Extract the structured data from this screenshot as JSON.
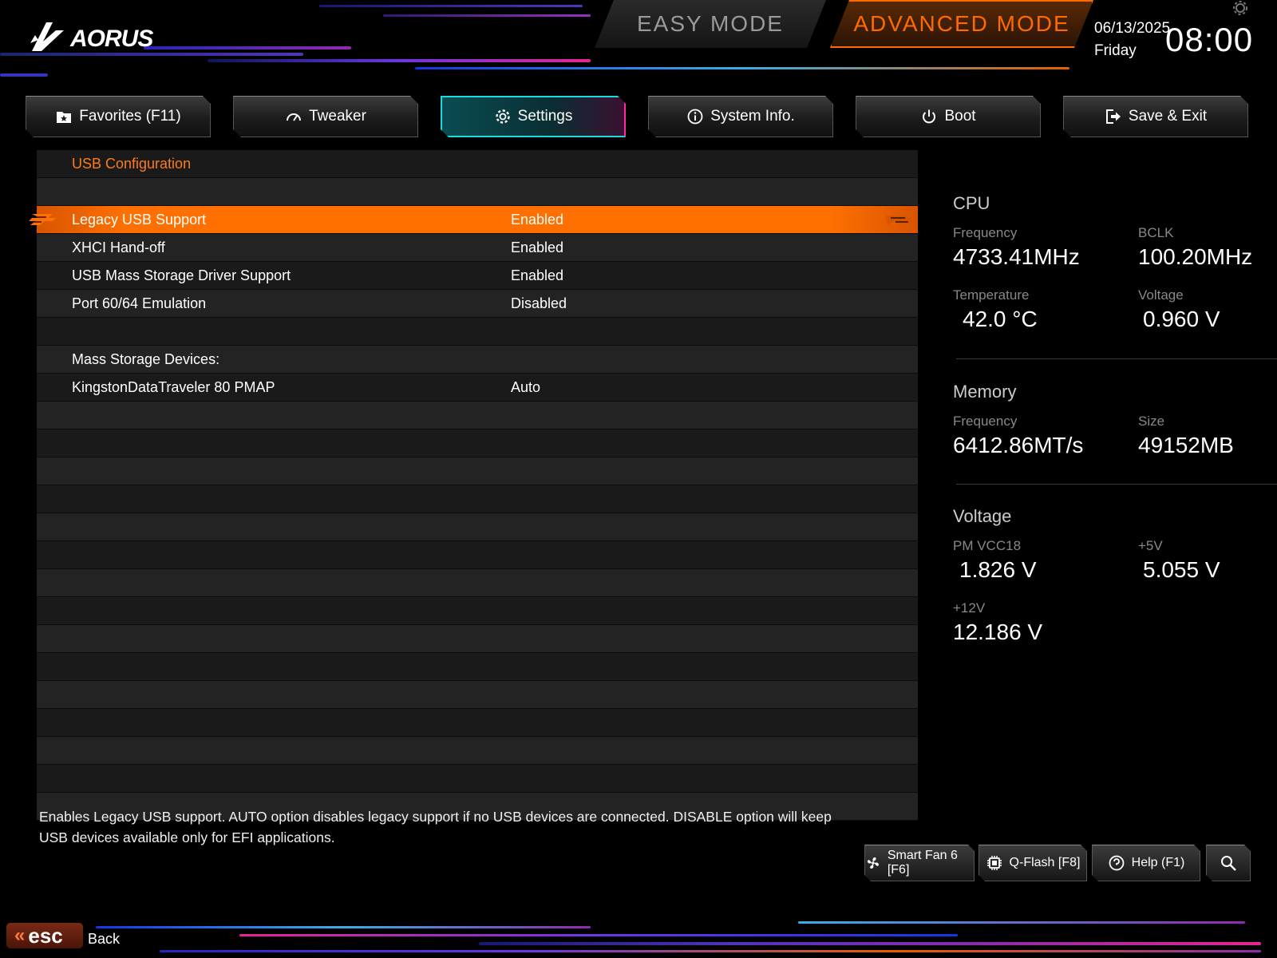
{
  "header": {
    "logo_text": "AORUS",
    "easy_mode": "EASY MODE",
    "advanced_mode": "ADVANCED MODE",
    "date": "06/13/2025",
    "day": "Friday",
    "time": "08:00"
  },
  "tabs": [
    {
      "label": "Favorites (F11)",
      "icon": "star-folder-icon"
    },
    {
      "label": "Tweaker",
      "icon": "gauge-icon"
    },
    {
      "label": "Settings",
      "icon": "gear-icon",
      "active": true
    },
    {
      "label": "System Info.",
      "icon": "info-icon"
    },
    {
      "label": "Boot",
      "icon": "power-icon"
    },
    {
      "label": "Save & Exit",
      "icon": "exit-icon"
    }
  ],
  "settings": {
    "section_title": "USB Configuration",
    "rows": [
      {
        "label": "Legacy USB Support",
        "value": "Enabled"
      },
      {
        "label": "XHCI Hand-off",
        "value": "Enabled"
      },
      {
        "label": "USB Mass Storage Driver Support",
        "value": "Enabled"
      },
      {
        "label": "Port 60/64 Emulation",
        "value": "Disabled"
      },
      {
        "label": "Mass Storage Devices:",
        "value": ""
      },
      {
        "label": "KingstonDataTraveler 80 PMAP",
        "value": "Auto"
      }
    ]
  },
  "monitor": {
    "cpu": {
      "title": "CPU",
      "frequency_label": "Frequency",
      "frequency": "4733.41MHz",
      "bclk_label": "BCLK",
      "bclk": "100.20MHz",
      "temperature_label": "Temperature",
      "temperature": "42.0 °C",
      "voltage_label": "Voltage",
      "voltage": "0.960 V"
    },
    "memory": {
      "title": "Memory",
      "frequency_label": "Frequency",
      "frequency": "6412.86MT/s",
      "size_label": "Size",
      "size": "49152MB"
    },
    "voltage": {
      "title": "Voltage",
      "pm_label": "PM VCC18",
      "pm": "1.826 V",
      "p5_label": "+5V",
      "p5": "5.055 V",
      "p12_label": "+12V",
      "p12": "12.186 V"
    }
  },
  "description": "Enables Legacy USB support. AUTO option disables legacy support if no USB devices are connected. DISABLE option will keep USB devices available only for EFI applications.",
  "bottom_buttons": {
    "smart_fan": "Smart Fan 6 [F6]",
    "qflash": "Q-Flash [F8]",
    "help": "Help (F1)"
  },
  "footer": {
    "esc": "esc",
    "back": "Back"
  },
  "colors": {
    "accent": "#ff6a00",
    "active_tab": "#20d8e0",
    "active_tab_edge": "#ff2aa0"
  }
}
